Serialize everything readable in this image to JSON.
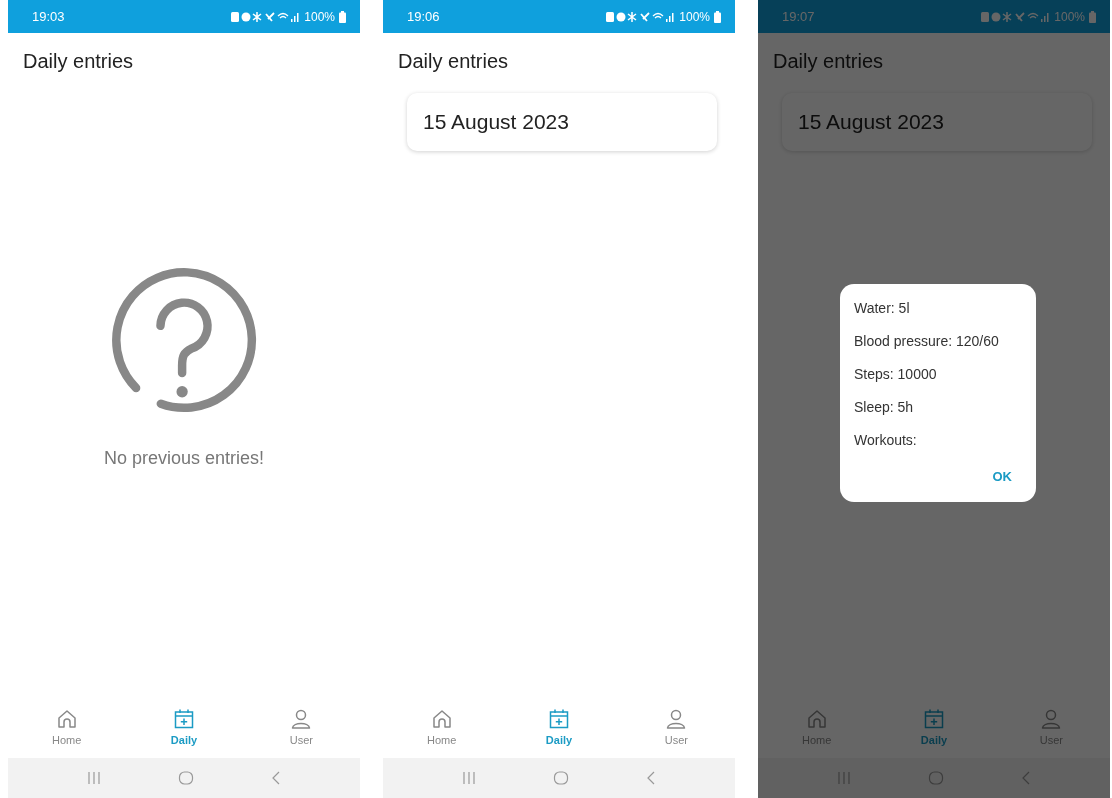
{
  "screens": [
    {
      "status_bar": {
        "time": "19:03",
        "battery": "100%"
      },
      "title": "Daily entries",
      "empty_state": {
        "message": "No previous entries!"
      },
      "nav": [
        {
          "label": "Home",
          "selected": false
        },
        {
          "label": "Daily",
          "selected": true
        },
        {
          "label": "User",
          "selected": false
        }
      ]
    },
    {
      "status_bar": {
        "time": "19:06",
        "battery": "100%"
      },
      "title": "Daily entries",
      "entries": [
        {
          "date": "15 August 2023"
        }
      ],
      "nav": [
        {
          "label": "Home",
          "selected": false
        },
        {
          "label": "Daily",
          "selected": true
        },
        {
          "label": "User",
          "selected": false
        }
      ]
    },
    {
      "status_bar": {
        "time": "19:07",
        "battery": "100%"
      },
      "title": "Daily entries",
      "entries": [
        {
          "date": "15 August 2023"
        }
      ],
      "dialog": {
        "lines": [
          "Water: 5l",
          "Blood pressure: 120/60",
          "Steps: 10000",
          "Sleep: 5h",
          "Workouts:"
        ],
        "button": "OK"
      },
      "nav": [
        {
          "label": "Home",
          "selected": false
        },
        {
          "label": "Daily",
          "selected": true
        },
        {
          "label": "User",
          "selected": false
        }
      ]
    }
  ]
}
